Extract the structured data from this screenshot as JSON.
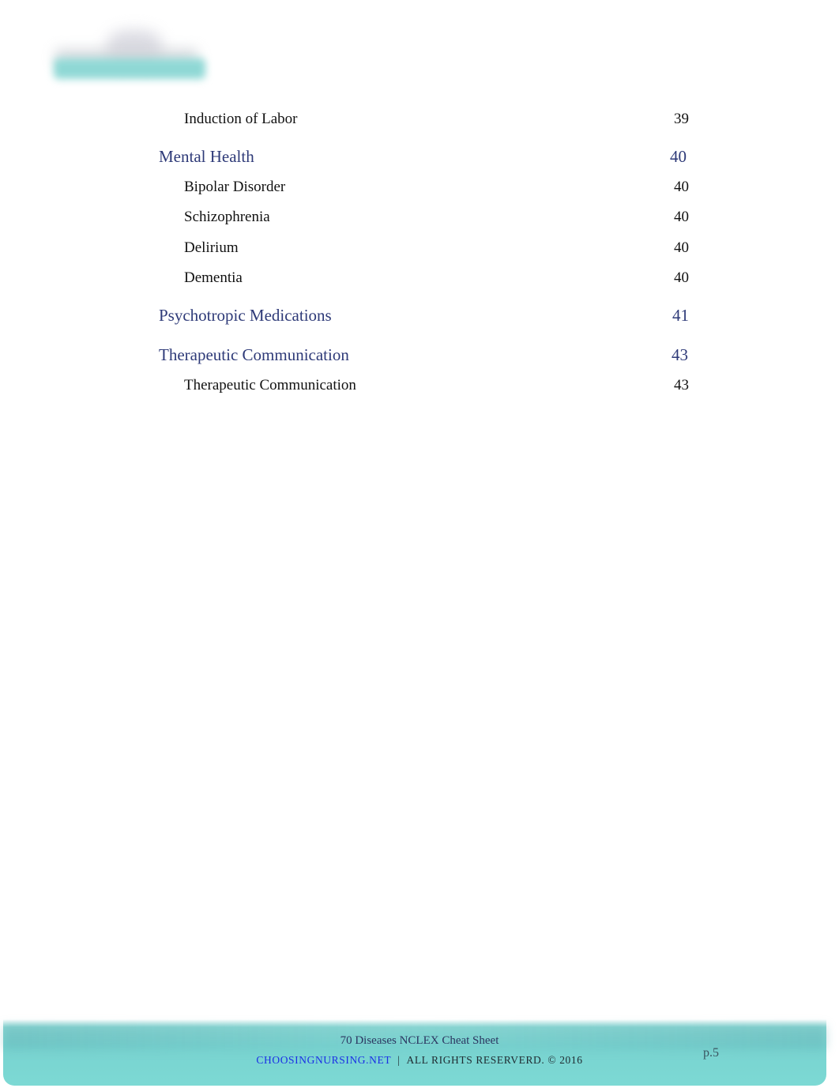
{
  "logo": {
    "icon": "choosingnursing-logo"
  },
  "toc": [
    {
      "type": "sub",
      "label": "Induction of Labor",
      "page": "39"
    },
    {
      "type": "head",
      "label": "Mental Health",
      "page": "40"
    },
    {
      "type": "sub",
      "label": "Bipolar Disorder",
      "page": "40"
    },
    {
      "type": "sub",
      "label": "Schizophrenia",
      "page": "40"
    },
    {
      "type": "sub",
      "label": "Delirium",
      "page": "40"
    },
    {
      "type": "sub",
      "label": "Dementia",
      "page": "40"
    },
    {
      "type": "head",
      "label": "Psychotropic Medications",
      "page": "41"
    },
    {
      "type": "head",
      "label": "Therapeutic Communication",
      "page": "43"
    },
    {
      "type": "sub",
      "label": "Therapeutic Communication",
      "page": "43"
    }
  ],
  "footer": {
    "title": "70 Diseases NCLEX Cheat Sheet",
    "site": "CHOOSINGNURSING.NET",
    "separator": "|",
    "rights": "ALL RIGHTS RESERVERD. © 2016",
    "page_label": "p.5"
  },
  "colors": {
    "heading": "#2e3a78",
    "footer_band": "#7cd9d4",
    "link": "#1a2ee6"
  }
}
